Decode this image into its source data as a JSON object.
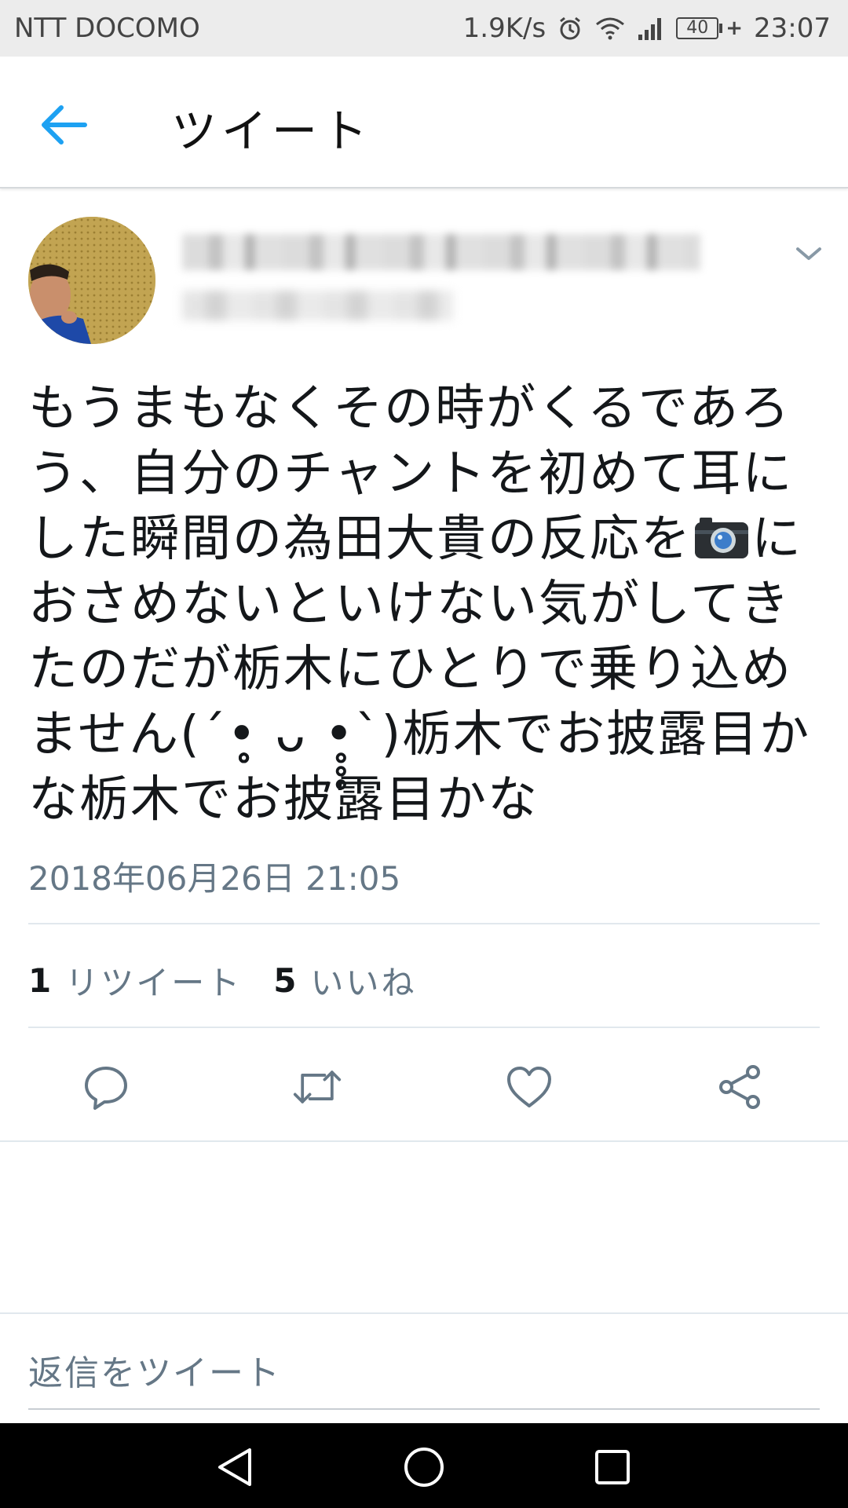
{
  "status_bar": {
    "carrier": "NTT DOCOMO",
    "net_speed": "1.9K/s",
    "battery": "40",
    "time": "23:07",
    "icons": [
      "alarm-icon",
      "wifi-icon",
      "signal-icon",
      "battery-icon"
    ]
  },
  "header": {
    "title": "ツイート",
    "back_icon": "arrow-left-icon"
  },
  "tweet": {
    "text": "もうまもなくその時がくるであろう、自分のチャントを初めて耳にした瞬間の為田大貴の反応を",
    "text_after_emoji": "におさめないといけない気がしてきたのだが栃木にひとりで乗り込めません(´•̥̥̥ ᴗ •̥̥̥`)栃木でお披露目かな栃木でお披露目かな",
    "emoji": "camera-emoji",
    "timestamp": "2018年06月26日 21:05",
    "retweet_count": "1",
    "retweet_label": "リツイート",
    "like_count": "5",
    "like_label": "いいね"
  },
  "actions": [
    "reply-icon",
    "retweet-icon",
    "like-icon",
    "share-icon"
  ],
  "reply": {
    "placeholder": "返信をツイート"
  },
  "colors": {
    "accent": "#1da1f2",
    "secondary_text": "#657786",
    "divider": "#e1e8ed"
  }
}
